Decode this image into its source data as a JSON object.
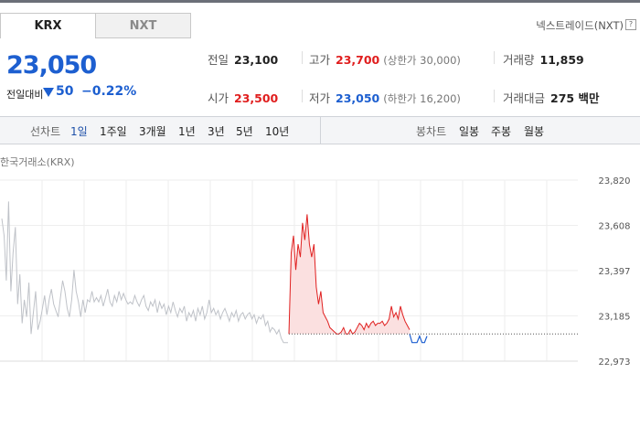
{
  "tabs": [
    {
      "label": "KRX",
      "active": true
    },
    {
      "label": "NXT",
      "active": false
    }
  ],
  "nxt_link": "넥스트레이드(NXT)",
  "nxt_help": "?",
  "price": {
    "current": "23,050",
    "change_label": "전일대비",
    "change_value": "50",
    "change_pct": "−0.22%",
    "direction": "down"
  },
  "stats": {
    "prev_close": {
      "label": "전일",
      "value": "23,100"
    },
    "high": {
      "label": "고가",
      "value": "23,700",
      "sub": "(상한가 30,000)"
    },
    "volume": {
      "label": "거래량",
      "value": "11,859"
    },
    "open": {
      "label": "시가",
      "value": "23,500"
    },
    "low": {
      "label": "저가",
      "value": "23,050",
      "sub": "(하한가 16,200)"
    },
    "amount": {
      "label": "거래대금",
      "value": "275 백만"
    }
  },
  "controls": {
    "line_label": "선차트",
    "line_periods": [
      "1일",
      "1주일",
      "3개월",
      "1년",
      "3년",
      "5년",
      "10년"
    ],
    "active_period": "1일",
    "candle_label": "봉차트",
    "candle_periods": [
      "일봉",
      "주봉",
      "월봉"
    ]
  },
  "chart_data": {
    "type": "line",
    "title": "한국거래소(KRX)",
    "y_ticks": [
      "23,820",
      "23,608",
      "23,397",
      "23,185",
      "22,973"
    ],
    "ylim": [
      22973,
      23820
    ],
    "reference_line": 23100,
    "colors": {
      "prior": "#bfc2c8",
      "up": "#e02020",
      "up_fill": "#fbe0e0",
      "down": "#1d5fd0"
    },
    "series": [
      {
        "values": [
          23640,
          23560,
          23350,
          23720,
          23300,
          23480,
          23600,
          23240,
          23380,
          23150,
          23260,
          23180,
          23340,
          23100,
          23200,
          23300,
          23120,
          23160,
          23220,
          23280,
          23190,
          23260,
          23310,
          23240,
          23210,
          23180,
          23270,
          23350,
          23300,
          23220,
          23180,
          23260,
          23400,
          23300,
          23250,
          23180,
          23260,
          23200,
          23260,
          23250,
          23300,
          23250,
          23270,
          23250,
          23280,
          23230,
          23270,
          23310,
          23250,
          23230,
          23280,
          23250,
          23300,
          23260,
          23290,
          23260,
          23240,
          23250,
          23240,
          23280,
          23250,
          23230,
          23260,
          23280,
          23230,
          23210,
          23250,
          23230,
          23260,
          23200,
          23250,
          23220,
          23240,
          23190,
          23230,
          23200,
          23250,
          23210,
          23180,
          23220,
          23200,
          23230,
          23160,
          23200,
          23180,
          23210,
          23160,
          23220,
          23190,
          23230,
          23170,
          23200,
          23260,
          23200,
          23220,
          23190,
          23210,
          23170,
          23200,
          23220,
          23190,
          23160,
          23200,
          23180,
          23210,
          23160,
          23190,
          23200,
          23170,
          23190,
          23200,
          23170,
          23190,
          23150,
          23180,
          23170,
          23190,
          23140,
          23160,
          23110,
          23130,
          23120,
          23100,
          23120,
          23080,
          23060,
          23060,
          23060
        ]
      },
      {
        "values": [
          23100,
          23480,
          23560,
          23400,
          23520,
          23460,
          23620,
          23540,
          23660,
          23520,
          23460,
          23520,
          23320,
          23240,
          23300,
          23200,
          23180,
          23160,
          23130,
          23120,
          23110,
          23100,
          23100,
          23110,
          23130,
          23100,
          23100,
          23120,
          23100,
          23110,
          23130,
          23150,
          23140,
          23120,
          23150,
          23130,
          23150,
          23160,
          23140,
          23150,
          23150,
          23160,
          23140,
          23150,
          23170,
          23230,
          23180,
          23200,
          23170,
          23230,
          23190,
          23160,
          23140,
          23120
        ]
      },
      {
        "values": [
          23100,
          23060,
          23060,
          23060,
          23090,
          23060,
          23060,
          23090
        ]
      }
    ]
  }
}
